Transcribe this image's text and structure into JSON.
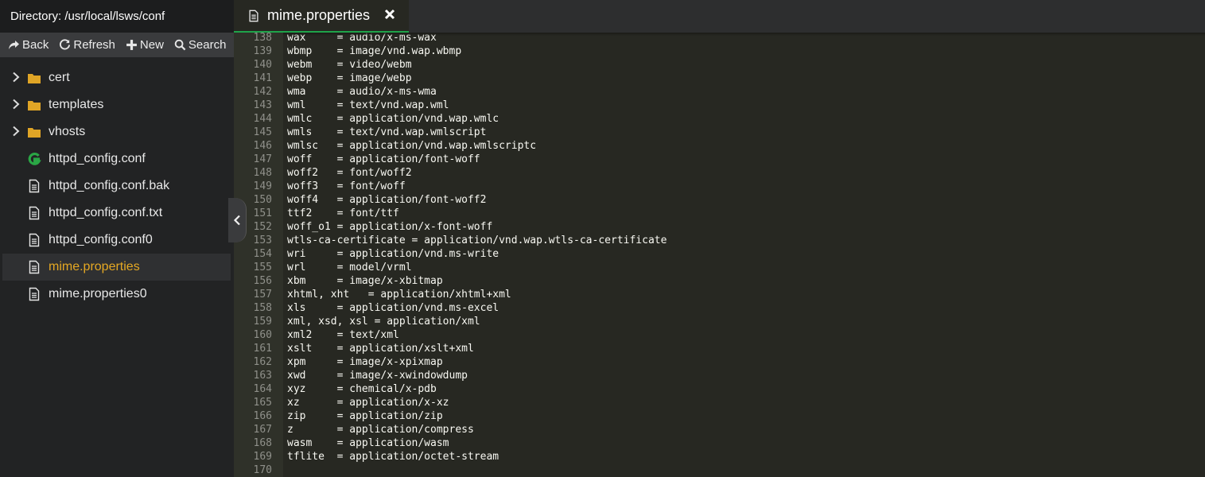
{
  "sidebar": {
    "directory_label": "Directory: /usr/local/lsws/conf",
    "toolbar": [
      {
        "label": "Back",
        "icon": "share-arrow-icon"
      },
      {
        "label": "Refresh",
        "icon": "refresh-icon"
      },
      {
        "label": "New",
        "icon": "plus-icon"
      },
      {
        "label": "Search",
        "icon": "search-icon"
      }
    ],
    "items": [
      {
        "label": "cert",
        "type": "folder"
      },
      {
        "label": "templates",
        "type": "folder"
      },
      {
        "label": "vhosts",
        "type": "folder"
      },
      {
        "label": "httpd_config.conf",
        "type": "conf"
      },
      {
        "label": "httpd_config.conf.bak",
        "type": "file"
      },
      {
        "label": "httpd_config.conf.txt",
        "type": "file"
      },
      {
        "label": "httpd_config.conf0",
        "type": "file"
      },
      {
        "label": "mime.properties",
        "type": "file",
        "active": true
      },
      {
        "label": "mime.properties0",
        "type": "file"
      }
    ]
  },
  "editor": {
    "tab_label": "mime.properties",
    "lines": [
      {
        "n": "138",
        "text": "wax     = audio/x-ms-wax"
      },
      {
        "n": "139",
        "text": "wbmp    = image/vnd.wap.wbmp"
      },
      {
        "n": "140",
        "text": "webm    = video/webm"
      },
      {
        "n": "141",
        "text": "webp    = image/webp"
      },
      {
        "n": "142",
        "text": "wma     = audio/x-ms-wma"
      },
      {
        "n": "143",
        "text": "wml     = text/vnd.wap.wml"
      },
      {
        "n": "144",
        "text": "wmlc    = application/vnd.wap.wmlc"
      },
      {
        "n": "145",
        "text": "wmls    = text/vnd.wap.wmlscript"
      },
      {
        "n": "146",
        "text": "wmlsc   = application/vnd.wap.wmlscriptc"
      },
      {
        "n": "147",
        "text": "woff    = application/font-woff"
      },
      {
        "n": "148",
        "text": "woff2   = font/woff2"
      },
      {
        "n": "149",
        "text": "woff3   = font/woff"
      },
      {
        "n": "150",
        "text": "woff4   = application/font-woff2"
      },
      {
        "n": "151",
        "text": "ttf2    = font/ttf"
      },
      {
        "n": "152",
        "text": "woff_o1 = application/x-font-woff"
      },
      {
        "n": "153",
        "text": "wtls-ca-certificate = application/vnd.wap.wtls-ca-certificate"
      },
      {
        "n": "154",
        "text": "wri     = application/vnd.ms-write"
      },
      {
        "n": "155",
        "text": "wrl     = model/vrml"
      },
      {
        "n": "156",
        "text": "xbm     = image/x-xbitmap"
      },
      {
        "n": "157",
        "text": "xhtml, xht   = application/xhtml+xml"
      },
      {
        "n": "158",
        "text": "xls     = application/vnd.ms-excel"
      },
      {
        "n": "159",
        "text": "xml, xsd, xsl = application/xml"
      },
      {
        "n": "160",
        "text": "xml2    = text/xml"
      },
      {
        "n": "161",
        "text": "xslt    = application/xslt+xml"
      },
      {
        "n": "162",
        "text": "xpm     = image/x-xpixmap"
      },
      {
        "n": "163",
        "text": "xwd     = image/x-xwindowdump"
      },
      {
        "n": "164",
        "text": "xyz     = chemical/x-pdb"
      },
      {
        "n": "165",
        "text": "xz      = application/x-xz"
      },
      {
        "n": "166",
        "text": "zip     = application/zip"
      },
      {
        "n": "167",
        "text": "z       = application/compress"
      },
      {
        "n": "168",
        "text": "wasm    = application/wasm"
      },
      {
        "n": "169",
        "text": "tflite  = application/octet-stream"
      },
      {
        "n": "170",
        "text": ""
      }
    ]
  },
  "colors": {
    "editor_bg": "#272822",
    "active_file": "#e5a823",
    "tab_underline": "#1fa34a",
    "folder": "#e0a526",
    "conf_icon": "#2aa645"
  }
}
